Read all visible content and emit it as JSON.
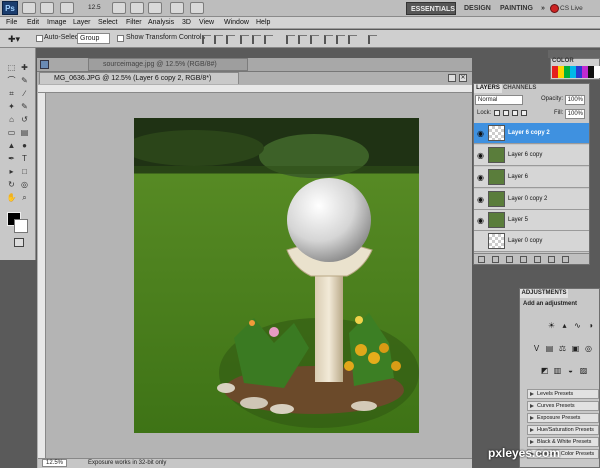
{
  "app": {
    "logo": "Ps",
    "workspaces": [
      "ESSENTIALS",
      "DESIGN",
      "PAINTING",
      "»"
    ],
    "cslive": "CS Live",
    "zoom_field": "12.5"
  },
  "menu": [
    "File",
    "Edit",
    "Image",
    "Layer",
    "Select",
    "Filter",
    "Analysis",
    "3D",
    "View",
    "Window",
    "Help"
  ],
  "options": {
    "auto_select_label": "Auto-Select:",
    "auto_select_value": "Group",
    "show_transform_label": "Show Transform Controls"
  },
  "document": {
    "back_tab": "sourceimage.jpg @ 12.5% (RGB/8#)",
    "active_tab": "MG_0636.JPG @ 12.5% (Layer 6 copy 2, RGB/8*)",
    "zoom": "12.5%",
    "status": "Exposure works in 32-bit only"
  },
  "color_panel": {
    "title": "COLOR",
    "swatches": [
      "#e52020",
      "#ffd600",
      "#00b03a",
      "#00b8e8",
      "#2a3bd0",
      "#c02ad0",
      "#111111",
      "#ffffff"
    ]
  },
  "layers_panel": {
    "tab_layers": "LAYERS",
    "tab_channels": "CHANNELS",
    "blend_mode": "Normal",
    "opacity_label": "Opacity:",
    "opacity_value": "100%",
    "lock_label": "Lock:",
    "fill_label": "Fill:",
    "fill_value": "100%",
    "layers": [
      {
        "name": "Layer 6 copy 2",
        "selected": true,
        "visible": true
      },
      {
        "name": "Layer 6 copy",
        "selected": false,
        "visible": true
      },
      {
        "name": "Layer 6",
        "selected": false,
        "visible": true
      },
      {
        "name": "Layer 0 copy 2",
        "selected": false,
        "visible": true
      },
      {
        "name": "Layer 5",
        "selected": false,
        "visible": true
      },
      {
        "name": "Layer 0 copy",
        "selected": false,
        "visible": false
      }
    ]
  },
  "adjustments": {
    "tab": "ADJUSTMENTS",
    "title": "Add an adjustment",
    "presets": [
      "Levels Presets",
      "Curves Presets",
      "Exposure Presets",
      "Hue/Saturation Presets",
      "Black & White Presets",
      "Selective Color Presets"
    ]
  },
  "watermark": "pxleyes.com"
}
